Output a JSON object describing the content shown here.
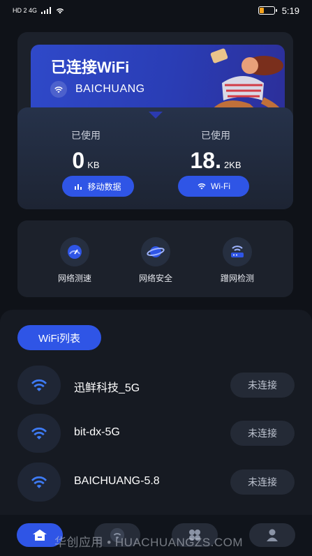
{
  "status": {
    "left_indicators": "HD 2 4G",
    "time": "5:19"
  },
  "banner": {
    "title": "已连接WiFi",
    "ssid": "BAICHUANG"
  },
  "usage": {
    "mobile": {
      "label": "已使用",
      "value": "0",
      "unit": "KB",
      "button": "移动数据"
    },
    "wifi": {
      "label": "已使用",
      "value": "18.",
      "unit": "2KB",
      "button": "Wi-Fi"
    }
  },
  "tools": [
    {
      "label": "网络测速",
      "icon": "speedometer-icon"
    },
    {
      "label": "网络安全",
      "icon": "planet-icon"
    },
    {
      "label": "蹭网检测",
      "icon": "router-icon"
    }
  ],
  "wifi_list": {
    "title": "WiFi列表",
    "items": [
      {
        "name": "迅鲜科技_5G",
        "status": "未连接"
      },
      {
        "name": "bit-dx-5G",
        "status": "未连接"
      },
      {
        "name": "BAICHUANG-5.8",
        "status": "未连接"
      }
    ]
  },
  "watermark": "华创应用 • HUACHUANGZS.COM",
  "tabs": [
    {
      "name": "home-icon",
      "active": true
    },
    {
      "name": "wifi-icon",
      "active": false
    },
    {
      "name": "tools-icon",
      "active": false
    },
    {
      "name": "user-icon",
      "active": false
    }
  ],
  "colors": {
    "accent": "#2f55e6",
    "background": "#0f1218",
    "card": "#1c212b"
  }
}
